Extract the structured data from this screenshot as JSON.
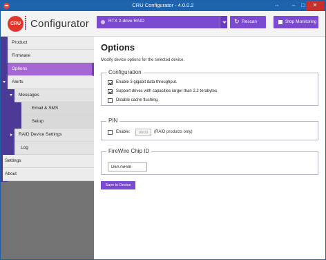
{
  "window": {
    "title": "CRU Configurator - 4.0.0.2",
    "controls": {
      "resize": "↔",
      "minimize": "–",
      "maximize": "□",
      "close": "✕"
    }
  },
  "header": {
    "logo_text": "CRU",
    "app_name": "Configurator",
    "device": {
      "selected": "RTX 2-drive RAID"
    },
    "rescan_label": "Rescan",
    "rescan_icon": "refresh-icon",
    "stop_label": "Stop Monitoring",
    "stop_icon": "stop-icon"
  },
  "sidebar": {
    "items": [
      {
        "label": "Product"
      },
      {
        "label": "Firmware"
      },
      {
        "label": "Options",
        "selected": true
      },
      {
        "label": "Alerts",
        "expanded": true
      },
      {
        "label": "Messages",
        "expanded": true
      },
      {
        "label": "Email & SMS"
      },
      {
        "label": "Setup"
      },
      {
        "label": "RAID Device Settings",
        "expanded": false
      },
      {
        "label": "Log"
      },
      {
        "label": "Settings"
      },
      {
        "label": "About"
      }
    ]
  },
  "main": {
    "title": "Options",
    "description": "Modify device options for the selected device.",
    "configuration": {
      "legend": "Configuration",
      "options": [
        {
          "label": "Enable 3 gigabit data throughput.",
          "checked": true
        },
        {
          "label": "Support drives with capacities larger than 2.2 terabytes.",
          "checked": true
        },
        {
          "label": "Disable cache flushing.",
          "checked": false
        }
      ]
    },
    "pin": {
      "legend": "PIN",
      "enable_label": "Enable:",
      "enabled": false,
      "value": "0000",
      "note": "(RAID products only)"
    },
    "firewire": {
      "legend": "FireWire Chip ID",
      "value": "D6A75F88"
    },
    "save_label": "Save to Device"
  },
  "colors": {
    "accent_purple": "#7b4ad1",
    "selected_nav": "#a567d4",
    "nav_strip": "#4b3b97",
    "title_bar": "#1e63ad",
    "logo_red": "#e2362c"
  }
}
